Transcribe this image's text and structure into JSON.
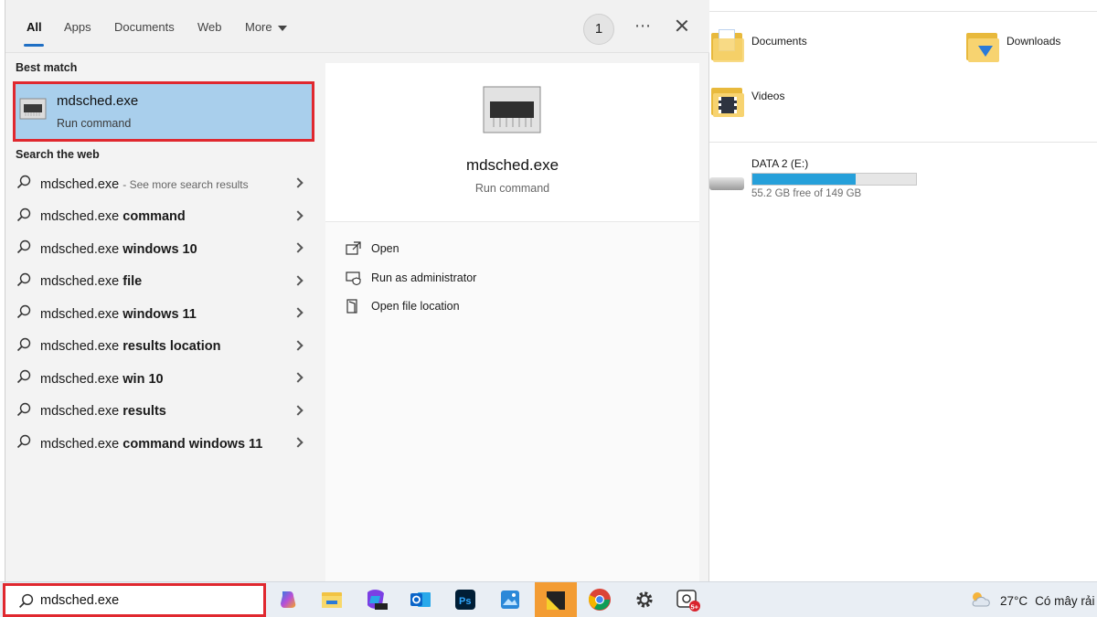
{
  "search_panel": {
    "tabs": [
      {
        "label": "All",
        "active": true
      },
      {
        "label": "Apps"
      },
      {
        "label": "Documents"
      },
      {
        "label": "Web"
      },
      {
        "label": "More"
      }
    ],
    "badge_count": "1",
    "best_match_heading": "Best match",
    "best_match": {
      "title": "mdsched.exe",
      "subtitle": "Run command"
    },
    "web_heading": "Search the web",
    "web_results": [
      {
        "base": "mdsched.exe",
        "bold": "",
        "suffix": "- See more search results"
      },
      {
        "base": "mdsched.exe",
        "bold": "command"
      },
      {
        "base": "mdsched.exe",
        "bold": "windows 10"
      },
      {
        "base": "mdsched.exe",
        "bold": "file"
      },
      {
        "base": "mdsched.exe",
        "bold": "windows 11"
      },
      {
        "base": "mdsched.exe",
        "bold": "results location"
      },
      {
        "base": "mdsched.exe",
        "bold": "win 10"
      },
      {
        "base": "mdsched.exe",
        "bold": "results"
      },
      {
        "base": "mdsched.exe",
        "bold": "command windows 11"
      }
    ],
    "preview": {
      "title": "mdsched.exe",
      "subtitle": "Run command",
      "actions": [
        {
          "label": "Open",
          "icon": "open-icon"
        },
        {
          "label": "Run as administrator",
          "icon": "shield-admin-icon"
        },
        {
          "label": "Open file location",
          "icon": "file-location-icon"
        }
      ]
    }
  },
  "explorer": {
    "folders": [
      {
        "label": "Documents",
        "icon": "documents-folder-icon"
      },
      {
        "label": "Downloads",
        "icon": "downloads-folder-icon"
      },
      {
        "label": "Videos",
        "icon": "videos-folder-icon"
      }
    ],
    "drive": {
      "name": "DATA 2 (E:)",
      "free_text": "55.2 GB free of 149 GB",
      "used_fraction": 0.63
    }
  },
  "taskbar": {
    "search_value": "mdsched.exe",
    "apps": [
      "copilot-icon",
      "file-explorer-icon",
      "m365-icon",
      "outlook-icon",
      "photoshop-icon",
      "photos-icon",
      "sticky-notes-icon",
      "chrome-icon",
      "settings-icon",
      "snipping-tool-icon"
    ],
    "notification_badge": "5+",
    "weather": {
      "temp": "27°C",
      "condition": "Có mây rải"
    }
  },
  "colors": {
    "accent": "#1f6fc4",
    "highlight": "#a9cfec",
    "annotation": "#e0282f",
    "drive_fill": "#26a0da",
    "taskbar_active": "#f39c33"
  }
}
